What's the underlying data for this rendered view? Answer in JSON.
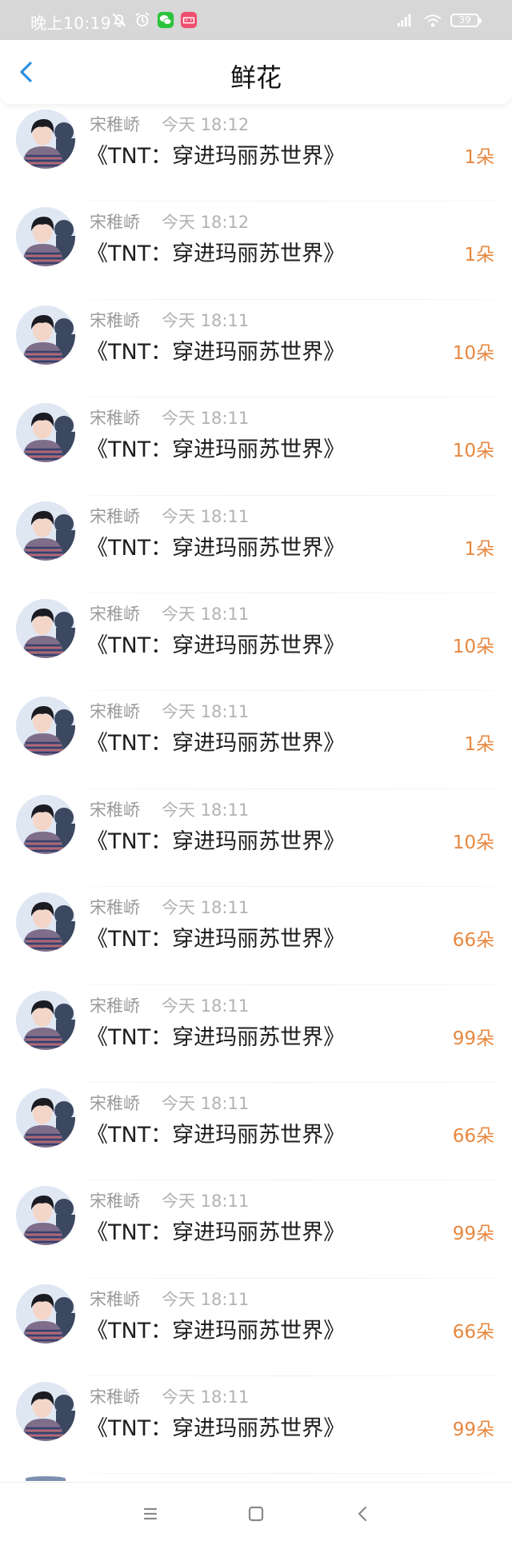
{
  "status_bar": {
    "time": "晚上10:19",
    "icons": [
      "mute-bell-icon",
      "alarm-icon",
      "wechat-icon",
      "app-icon",
      "signal-icon",
      "wifi-icon"
    ],
    "battery": "39",
    "colors": {
      "wechat": "#2bc33c",
      "app": "#f04d6e"
    }
  },
  "header": {
    "title": "鲜花",
    "back_icon": "chevron-left-icon",
    "accent_color": "#2d8fe0"
  },
  "accent_color": "#e7873f",
  "items": [
    {
      "sender": "宋稚峤",
      "time": "今天 18:12",
      "title": "《TNT：穿进玛丽苏世界》",
      "count": "1朵"
    },
    {
      "sender": "宋稚峤",
      "time": "今天 18:12",
      "title": "《TNT：穿进玛丽苏世界》",
      "count": "1朵"
    },
    {
      "sender": "宋稚峤",
      "time": "今天 18:11",
      "title": "《TNT：穿进玛丽苏世界》",
      "count": "10朵"
    },
    {
      "sender": "宋稚峤",
      "time": "今天 18:11",
      "title": "《TNT：穿进玛丽苏世界》",
      "count": "10朵"
    },
    {
      "sender": "宋稚峤",
      "time": "今天 18:11",
      "title": "《TNT：穿进玛丽苏世界》",
      "count": "1朵"
    },
    {
      "sender": "宋稚峤",
      "time": "今天 18:11",
      "title": "《TNT：穿进玛丽苏世界》",
      "count": "10朵"
    },
    {
      "sender": "宋稚峤",
      "time": "今天 18:11",
      "title": "《TNT：穿进玛丽苏世界》",
      "count": "1朵"
    },
    {
      "sender": "宋稚峤",
      "time": "今天 18:11",
      "title": "《TNT：穿进玛丽苏世界》",
      "count": "10朵"
    },
    {
      "sender": "宋稚峤",
      "time": "今天 18:11",
      "title": "《TNT：穿进玛丽苏世界》",
      "count": "66朵"
    },
    {
      "sender": "宋稚峤",
      "time": "今天 18:11",
      "title": "《TNT：穿进玛丽苏世界》",
      "count": "99朵"
    },
    {
      "sender": "宋稚峤",
      "time": "今天 18:11",
      "title": "《TNT：穿进玛丽苏世界》",
      "count": "66朵"
    },
    {
      "sender": "宋稚峤",
      "time": "今天 18:11",
      "title": "《TNT：穿进玛丽苏世界》",
      "count": "99朵"
    },
    {
      "sender": "宋稚峤",
      "time": "今天 18:11",
      "title": "《TNT：穿进玛丽苏世界》",
      "count": "66朵"
    },
    {
      "sender": "宋稚峤",
      "time": "今天 18:11",
      "title": "《TNT：穿进玛丽苏世界》",
      "count": "99朵"
    }
  ],
  "nav_bar": {
    "icons": [
      "menu-icon",
      "home-square-icon",
      "back-chevron-icon"
    ]
  }
}
